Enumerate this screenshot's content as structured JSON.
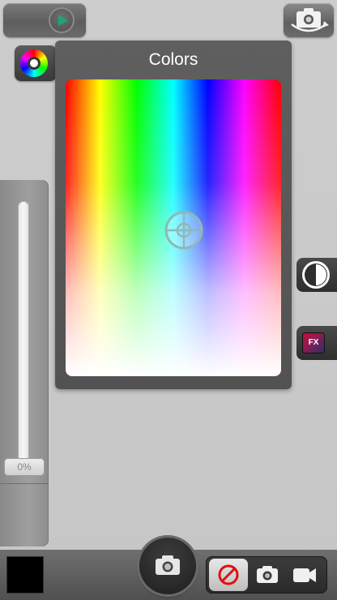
{
  "colors_panel": {
    "title": "Colors"
  },
  "slider": {
    "value_label": "0%"
  },
  "fx_button": {
    "label": "FX"
  },
  "selected_color": "#000000",
  "accent_colors": {
    "none_icon": "#e01010",
    "fx_badge": "#c0103a"
  },
  "icons": [
    "play-icon",
    "camera-switch-icon",
    "color-wheel-icon",
    "crosshair-icon",
    "timer-icon",
    "fx-icon",
    "shutter-camera-icon",
    "no-filter-icon",
    "photo-mode-icon",
    "video-mode-icon"
  ]
}
